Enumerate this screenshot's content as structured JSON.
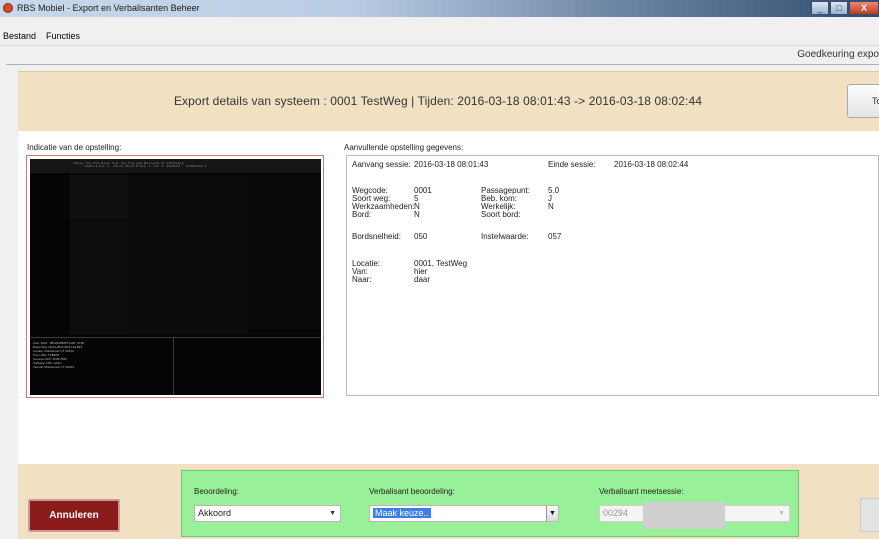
{
  "window": {
    "title": "RBS Mobiel - Export en Verbalisanten Beheer",
    "buttons": [
      "_",
      "□",
      "X"
    ]
  },
  "menu": [
    "Bestand",
    "Functies"
  ],
  "approval_label": "Goedkeuring expo",
  "header": {
    "text": "Export details van systeem : 0001 TestWeg  |  Tijden:  2016-03-18 08:01:43 -> 2016-03-18 08:02:44",
    "show_button": "Toon E"
  },
  "indicatie_label": "Indicatie van de opstelling:",
  "aanvullende_label": "Aanvullende opstelling gegevens:",
  "details": {
    "aanvang_label": "Aanvang sessie:",
    "aanvang_value": "2016-03-18 08:01:43",
    "einde_label": "Einde sessie:",
    "einde_value": "2016-03-18 08:02:44",
    "wegcode_label": "Wegcode:",
    "wegcode_value": "0001",
    "soortweg_label": "Soort weg:",
    "soortweg_value": "5",
    "werkzaamheden_label": "Werkzaamheden:",
    "werkzaamheden_value": "N",
    "bord_label": "Bord:",
    "bord_value": "N",
    "passagepunt_label": "Passagepunt:",
    "passagepunt_value": "5.0",
    "bebkom_label": "Beb. kom:",
    "bebkom_value": "J",
    "werkelijk_label": "Werkelijk:",
    "werkelijk_value": "N",
    "soortbord_label": "Soort bord:",
    "bordsnelheid_label": "Bordsnelheid:",
    "bordsnelheid_value": "050",
    "instelwaarde_label": "Instelwaarde:",
    "instelwaarde_value": "057",
    "locatie_label": "Locatie:",
    "locatie_value": "0001, TestWeg",
    "van_label": "Van:",
    "van_value": "hier",
    "naar_label": "Naar:",
    "naar_value": "daar"
  },
  "bottom": {
    "cancel_button": "Annuleren",
    "beoordeling_label": "Beoordeling:",
    "beoordeling_value": "Akkoord",
    "verbalisant_beoordeling_label": "Verbalisant beoordeling:",
    "verbalisant_beoordeling_value": "Maak keuze..",
    "verbalisant_meetsessie_label": "Verbalisant meetsessie:",
    "verbalisant_meetsessie_value": "00294"
  },
  "colors": {
    "header_band": "#f2e0c2",
    "green_panel": "#98f098",
    "cancel_button": "#8b1a1a"
  }
}
